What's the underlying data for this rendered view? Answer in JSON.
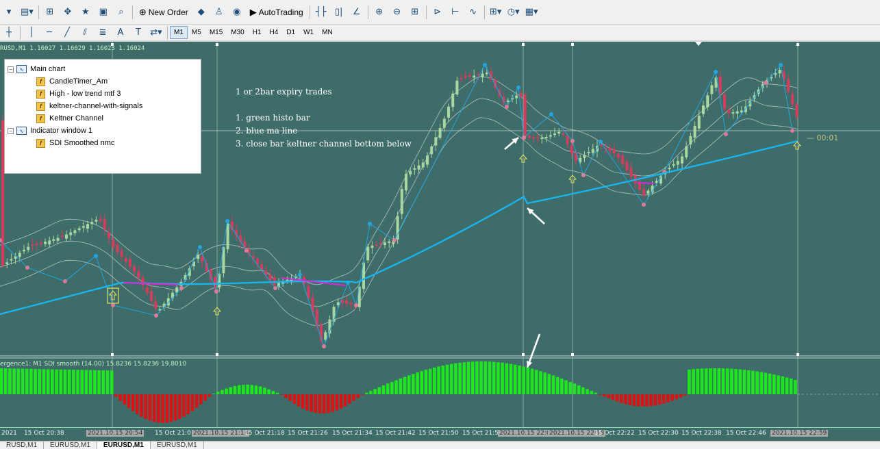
{
  "toolbar1": {
    "new_order_label": "New Order",
    "autotrading_label": "AutoTrading"
  },
  "toolbar2": {
    "timeframes": [
      "M1",
      "M5",
      "M15",
      "M30",
      "H1",
      "H4",
      "D1",
      "W1",
      "MN"
    ],
    "active_timeframe": "M1"
  },
  "chart": {
    "symbol_line": "RUSD,M1  1.16027 1.16029 1.16023 1.16024",
    "indicator_line": "ergence1:  M1   SDI smooth (14.00) 15.8236 15.8236 19.8010",
    "countdown": "— 00:01",
    "background": "#3e6c69",
    "bull_color": "#a8d8a0",
    "bear_color": "#d83c5c",
    "ma_color": "#19b4ee",
    "histo_up": "#1ee61e",
    "histo_down": "#d81414"
  },
  "notes": [
    "1 or 2bar expiry trades",
    "",
    "1. green histo bar",
    "2. blue ma line",
    "3. close bar keltner channel bottom below"
  ],
  "tree": {
    "main_label": "Main chart",
    "main_items": [
      "CandleTimer_Am",
      "High - low trend mtf 3",
      "keltner-channel-with-signals",
      "Keltner Channel"
    ],
    "sub_label": "Indicator window 1",
    "sub_items": [
      "SDI Smoothed nmc"
    ]
  },
  "time_axis": [
    {
      "label": "2021",
      "hl": false
    },
    {
      "label": "15 Oct 20:38",
      "hl": false
    },
    {
      "label": "2021.10.15 20:54",
      "hl": true
    },
    {
      "label": "15 Oct 21:0",
      "hl": false
    },
    {
      "label": "2021.10.15 21:13",
      "hl": true
    },
    {
      "label": "15 Oct 21:18",
      "hl": false
    },
    {
      "label": "15 Oct 21:26",
      "hl": false
    },
    {
      "label": "15 Oct 21:34",
      "hl": false
    },
    {
      "label": "15 Oct 21:42",
      "hl": false
    },
    {
      "label": "15 Oct 21:50",
      "hl": false
    },
    {
      "label": "15 Oct 21:5",
      "hl": false
    },
    {
      "label": "2021.10.15 22:0",
      "hl": true
    },
    {
      "label": "2021.10.15 22:18",
      "hl": true
    },
    {
      "label": "15 Oct 22:22",
      "hl": false
    },
    {
      "label": "15 Oct 22:30",
      "hl": false
    },
    {
      "label": "15 Oct 22:38",
      "hl": false
    },
    {
      "label": "15 Oct 22:46",
      "hl": false
    },
    {
      "label": "2021.10.15 22:59",
      "hl": true
    }
  ],
  "tabs": [
    {
      "label": "RUSD,M1",
      "active": false
    },
    {
      "label": "EURUSD,M1",
      "active": false
    },
    {
      "label": "EURUSD,M1",
      "active": true
    },
    {
      "label": "EURUSD,M1",
      "active": false
    }
  ]
}
